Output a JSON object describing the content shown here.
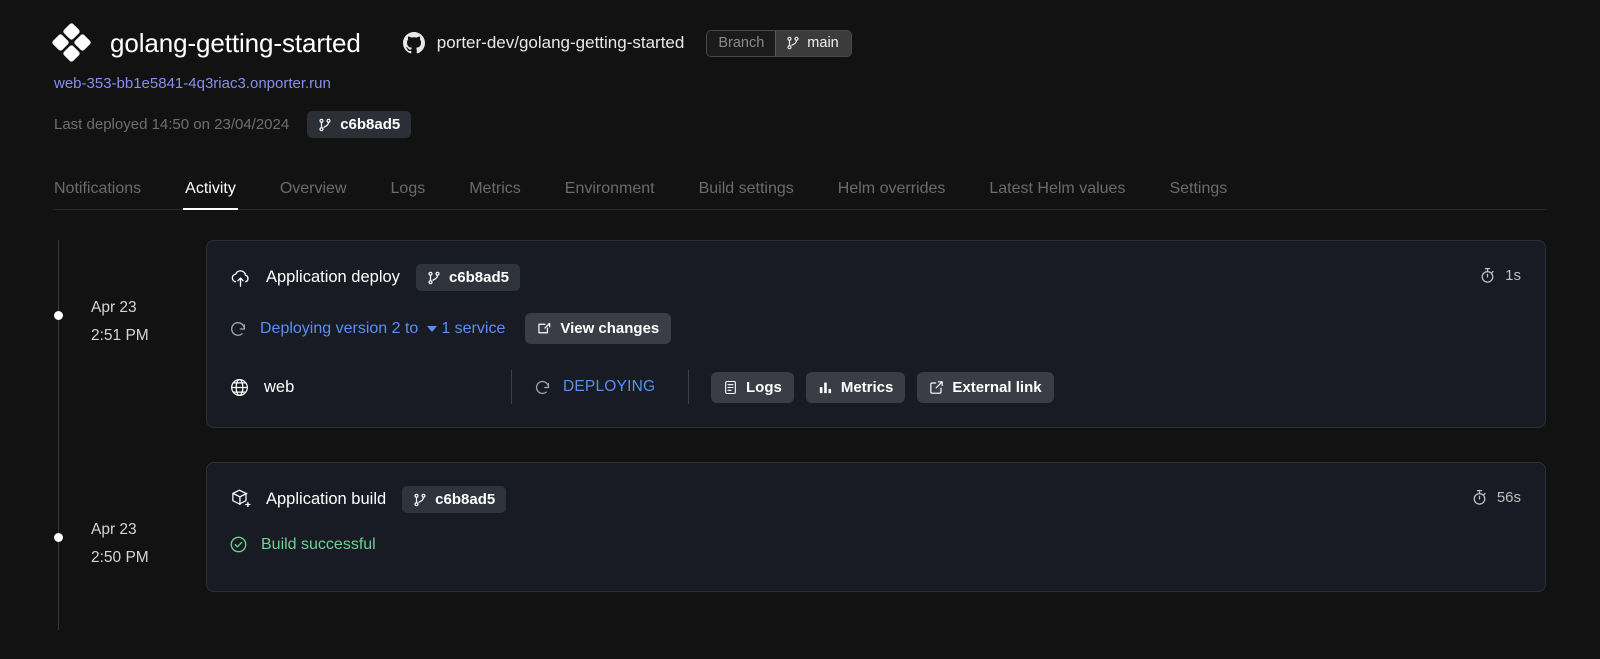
{
  "header": {
    "logo_icon": "porter-diamond-logo",
    "app_title": "golang-getting-started",
    "github_icon": "github-icon",
    "repo": "porter-dev/golang-getting-started",
    "branch_label": "Branch",
    "branch_icon": "git-branch-icon",
    "branch_value": "main"
  },
  "subheader": {
    "url": "web-353-bb1e5841-4q3riac3.onporter.run",
    "last_deployed": "Last deployed 14:50 on 23/04/2024",
    "commit_icon": "git-branch-icon",
    "commit": "c6b8ad5"
  },
  "tabs": [
    {
      "label": "Notifications",
      "active": false
    },
    {
      "label": "Activity",
      "active": true
    },
    {
      "label": "Overview",
      "active": false
    },
    {
      "label": "Logs",
      "active": false
    },
    {
      "label": "Metrics",
      "active": false
    },
    {
      "label": "Environment",
      "active": false
    },
    {
      "label": "Build settings",
      "active": false
    },
    {
      "label": "Helm overrides",
      "active": false
    },
    {
      "label": "Latest Helm values",
      "active": false
    },
    {
      "label": "Settings",
      "active": false
    }
  ],
  "events": [
    {
      "date": "Apr 23",
      "time": "2:51 PM",
      "icon": "cloud-upload-icon",
      "title": "Application deploy",
      "commit_icon": "git-branch-icon",
      "commit": "c6b8ad5",
      "duration_icon": "stopwatch-icon",
      "duration": "1s",
      "status_icon": "spinner-icon",
      "status_text": "Deploying version 2 to",
      "status_color": "#5a8ff0",
      "services_caret_icon": "chevron-down-icon",
      "services_count": "1 service",
      "view_changes_icon": "edit-square-icon",
      "view_changes_label": "View changes",
      "service": {
        "icon": "globe-icon",
        "name": "web",
        "status_icon": "spinner-icon",
        "status": "DEPLOYING",
        "buttons": [
          {
            "icon": "document-icon",
            "label": "Logs"
          },
          {
            "icon": "bar-chart-icon",
            "label": "Metrics"
          },
          {
            "icon": "external-link-icon",
            "label": "External link"
          }
        ]
      }
    },
    {
      "date": "Apr 23",
      "time": "2:50 PM",
      "icon": "box-plus-icon",
      "title": "Application build",
      "commit_icon": "git-branch-icon",
      "commit": "c6b8ad5",
      "duration_icon": "stopwatch-icon",
      "duration": "56s",
      "status_icon": "check-circle-icon",
      "status_text": "Build successful",
      "status_color": "#6fcf97"
    }
  ],
  "colors": {
    "page_bg": "#121212",
    "card_bg": "#181b23",
    "card_border": "#2b2f38",
    "link": "#8a8ef0",
    "blue": "#5a8ff0",
    "green": "#6fcf97",
    "muted": "#6b6b6b"
  }
}
